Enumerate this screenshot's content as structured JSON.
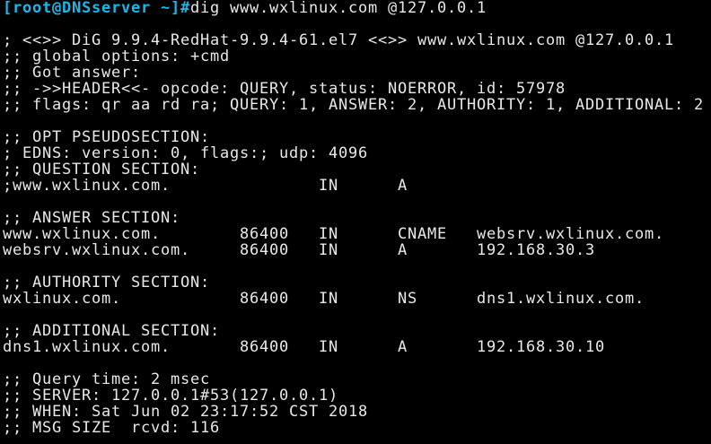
{
  "theme": {
    "background": "#000000",
    "text_color": "#e8e8e8",
    "prompt_color": "#1ab8e8"
  },
  "prompt": {
    "text": "[root@DNSserver ~]#",
    "command": "dig www.wxlinux.com @127.0.0.1"
  },
  "header": {
    "banner": "; <<>> DiG 9.9.4-RedHat-9.9.4-61.el7 <<>> www.wxlinux.com @127.0.0.1",
    "global_options": ";; global options: +cmd",
    "got_answer": ";; Got answer:",
    "header_line": ";; ->>HEADER<<- opcode: QUERY, status: NOERROR, id: 57978",
    "flags_line": ";; flags: qr aa rd ra; QUERY: 1, ANSWER: 2, AUTHORITY: 1, ADDITIONAL: 2"
  },
  "opt": {
    "title": ";; OPT PSEUDOSECTION:",
    "edns": "; EDNS: version: 0, flags:; udp: 4096"
  },
  "question": {
    "title": ";; QUESTION SECTION:",
    "records": [
      {
        "name": ";www.wxlinux.com.",
        "class": "IN",
        "type": "A"
      }
    ]
  },
  "answer": {
    "title": ";; ANSWER SECTION:",
    "records": [
      {
        "name": "www.wxlinux.com.",
        "ttl": "86400",
        "class": "IN",
        "type": "CNAME",
        "data": "websrv.wxlinux.com."
      },
      {
        "name": "websrv.wxlinux.com.",
        "ttl": "86400",
        "class": "IN",
        "type": "A",
        "data": "192.168.30.3"
      }
    ]
  },
  "authority": {
    "title": ";; AUTHORITY SECTION:",
    "records": [
      {
        "name": "wxlinux.com.",
        "ttl": "86400",
        "class": "IN",
        "type": "NS",
        "data": "dns1.wxlinux.com."
      }
    ]
  },
  "additional": {
    "title": ";; ADDITIONAL SECTION:",
    "records": [
      {
        "name": "dns1.wxlinux.com.",
        "ttl": "86400",
        "class": "IN",
        "type": "A",
        "data": "192.168.30.10"
      }
    ]
  },
  "footer": {
    "query_time": ";; Query time: 2 msec",
    "server": ";; SERVER: 127.0.0.1#53(127.0.0.1)",
    "when": ";; WHEN: Sat Jun 02 23:17:52 CST 2018",
    "msg_size": ";; MSG SIZE  rcvd: 116"
  }
}
